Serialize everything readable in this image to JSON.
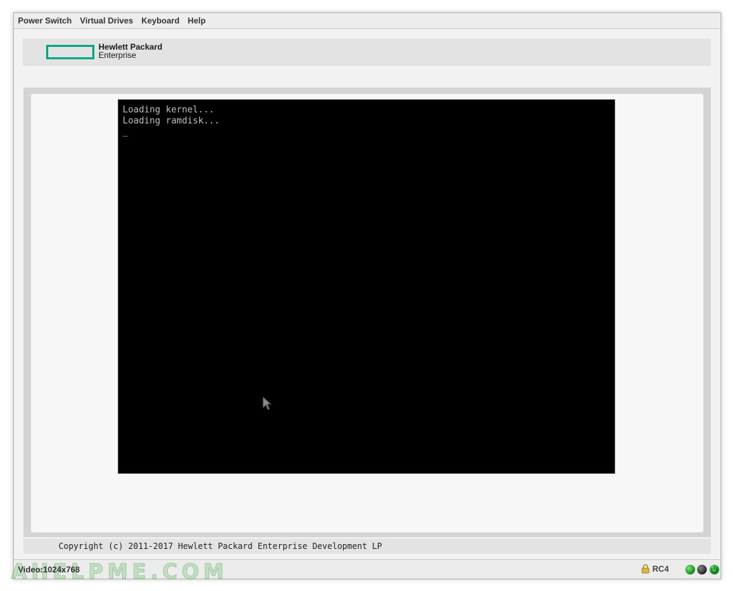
{
  "menubar": {
    "items": [
      {
        "label": "Power Switch"
      },
      {
        "label": "Virtual Drives"
      },
      {
        "label": "Keyboard"
      },
      {
        "label": "Help"
      }
    ]
  },
  "logo": {
    "line1": "Hewlett Packard",
    "line2": "Enterprise",
    "accent_color": "#01a982"
  },
  "console": {
    "lines": [
      "Loading kernel...",
      "Loading ramdisk..."
    ],
    "cursor": "_"
  },
  "footer": {
    "copyright": "Copyright (c) 2011-2017 Hewlett Packard Enterprise Development LP"
  },
  "statusbar": {
    "video": "Video:1024x768",
    "watermark": "AHELPME.COM",
    "encryption": "RC4",
    "indicators": [
      "green-led",
      "dark-led",
      "power-led"
    ]
  }
}
